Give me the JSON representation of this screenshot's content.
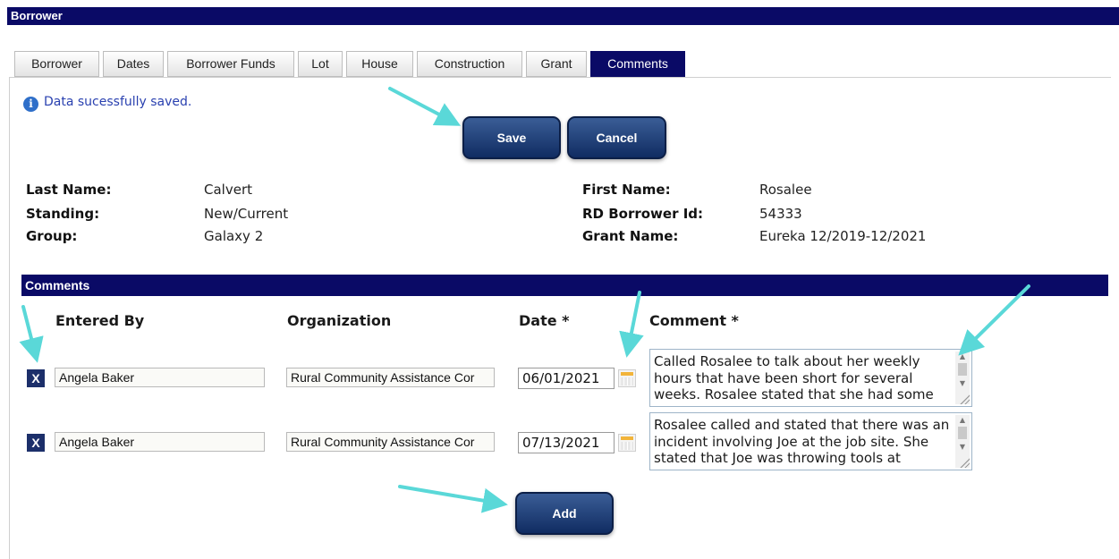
{
  "header": {
    "title": "Borrower"
  },
  "tabs": [
    {
      "label": "Borrower",
      "active": false
    },
    {
      "label": "Dates",
      "active": false
    },
    {
      "label": "Borrower Funds",
      "active": false
    },
    {
      "label": "Lot",
      "active": false
    },
    {
      "label": "House",
      "active": false
    },
    {
      "label": "Construction",
      "active": false
    },
    {
      "label": "Grant",
      "active": false
    },
    {
      "label": "Comments",
      "active": true
    }
  ],
  "message": {
    "icon": "info-icon",
    "text": "Data sucessfully saved."
  },
  "actions": {
    "save_label": "Save",
    "cancel_label": "Cancel",
    "add_label": "Add"
  },
  "borrower": {
    "last_name_label": "Last Name:",
    "last_name": "Calvert",
    "standing_label": "Standing:",
    "standing": "New/Current",
    "group_label": "Group:",
    "group": "Galaxy 2",
    "first_name_label": "First Name:",
    "first_name": "Rosalee",
    "rd_id_label": "RD Borrower Id:",
    "rd_id": "54333",
    "grant_label": "Grant Name:",
    "grant": "Eureka 12/2019-12/2021"
  },
  "comments_section": {
    "title": "Comments",
    "columns": {
      "entered_by": "Entered By",
      "organization": "Organization",
      "date": "Date *",
      "comment": "Comment *"
    },
    "delete_label": "X",
    "rows": [
      {
        "entered_by": "Angela Baker",
        "organization": "Rural Community Assistance Cor",
        "date": "06/01/2021",
        "comment": "Called Rosalee to talk about her weekly hours that have been short for several weeks. Rosalee stated that she had some"
      },
      {
        "entered_by": "Angela Baker",
        "organization": "Rural Community Assistance Cor",
        "date": "07/13/2021",
        "comment": "Rosalee called and stated that there was an incident involving Joe at the job site. She stated that Joe was throwing tools at"
      }
    ]
  },
  "colors": {
    "navy": "#0a0a66",
    "button": "#1b3a72",
    "arrow": "#5ad8d8",
    "message": "#2a41b0"
  }
}
